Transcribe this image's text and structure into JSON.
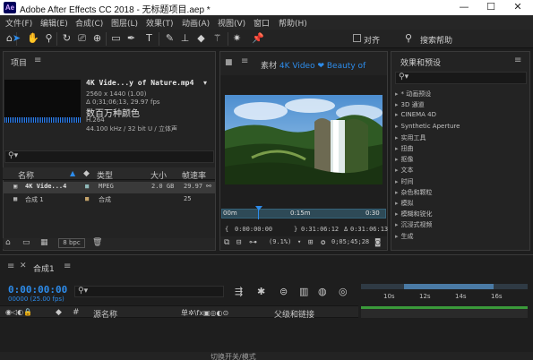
{
  "window": {
    "title": "Adobe After Effects CC 2018 - 无标题项目.aep *",
    "logo": "Ae",
    "minimize": "—",
    "maximize": "☐",
    "close": "✕"
  },
  "menu": [
    "文件(F)",
    "编辑(E)",
    "合成(C)",
    "图层(L)",
    "效果(T)",
    "动画(A)",
    "视图(V)",
    "窗口",
    "帮助(H)"
  ],
  "toolbar": {
    "align_label": "对齐",
    "search_help": "搜索帮助"
  },
  "project": {
    "title": "项目",
    "selected": {
      "name": "4K Vide...y of Nature.mp4",
      "resolution": "2560 x 1440 (1.00)",
      "duration": "Δ 0;31;06;13, 29.97 fps",
      "colors": "数百万种颜色",
      "codec": "H.264",
      "audio": "44.100 kHz / 32 bit U / 立体声"
    },
    "columns": {
      "name": "名称",
      "type": "类型",
      "size": "大小",
      "fps": "帧速率"
    },
    "rows": [
      {
        "name": "4K Vide...4",
        "type": "MPEG",
        "size": "2.0 GB",
        "fps": "29.97"
      },
      {
        "name": "合成 1",
        "type": "合成",
        "size": "",
        "fps": "25"
      }
    ],
    "bpc": "8 bpc"
  },
  "composition": {
    "tab_prefix": "素材",
    "tab_name": "4K Video ❤ Beauty of",
    "ruler": {
      "start": "00m",
      "mid": "0:15m",
      "end": "0:30"
    },
    "in_time": "0:00:00:00",
    "out_time": "0:31:06:12",
    "duration": "0:31:06:13",
    "zoom": "(9.1%)",
    "current_time": "0;05;45;28"
  },
  "effects": {
    "title": "效果和预设",
    "items": [
      "* 动画预设",
      "3D 通道",
      "CINEMA 4D",
      "Synthetic Aperture",
      "实用工具",
      "扭曲",
      "抠像",
      "文本",
      "时间",
      "杂色和颗粒",
      "模拟",
      "模糊和锐化",
      "沉浸式视频",
      "生成"
    ]
  },
  "timeline": {
    "tab": "合成1",
    "time": "0:00:00:00",
    "fps": "00000 (25.00 fps)",
    "col_source": "源名称",
    "col_parent": "父级和链接",
    "col_switches": "单✲\\fx▣◎◐⊙",
    "ticks": [
      "10s",
      "12s",
      "14s",
      "16s"
    ],
    "bottom_label": "切换开关/模式"
  }
}
